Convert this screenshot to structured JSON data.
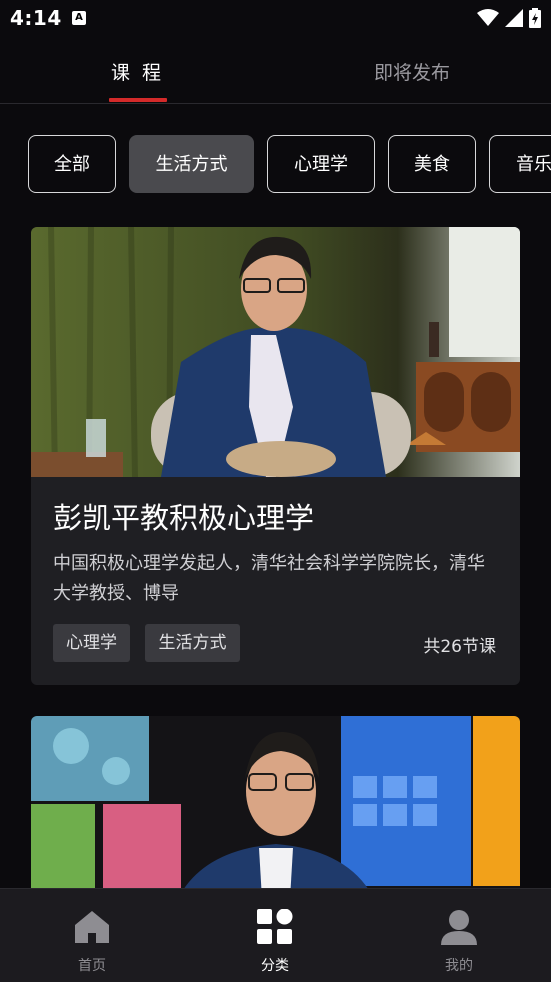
{
  "status_bar": {
    "time": "4:14",
    "notification_letter": "A"
  },
  "tabs": [
    {
      "label": "课 程",
      "active": true
    },
    {
      "label": "即将发布",
      "active": false
    }
  ],
  "categories": [
    {
      "label": "全部",
      "selected": false
    },
    {
      "label": "生活方式",
      "selected": true
    },
    {
      "label": "心理学",
      "selected": false
    },
    {
      "label": "美食",
      "selected": false
    },
    {
      "label": "音乐",
      "selected": false
    }
  ],
  "courses": [
    {
      "title": "彭凯平教积极心理学",
      "description": "中国积极心理学发起人，清华社会科学学院院长，清华大学教授、博导",
      "tags": [
        "心理学",
        "生活方式"
      ],
      "lesson_count": "共26节课"
    }
  ],
  "bottom_nav": [
    {
      "label": "首页",
      "icon": "home-icon",
      "active": false
    },
    {
      "label": "分类",
      "icon": "category-grid-icon",
      "active": true
    },
    {
      "label": "我的",
      "icon": "profile-icon",
      "active": false
    }
  ],
  "colors": {
    "accent": "#d42a2a",
    "background": "#0b0a0d",
    "card": "#1f1f23"
  }
}
